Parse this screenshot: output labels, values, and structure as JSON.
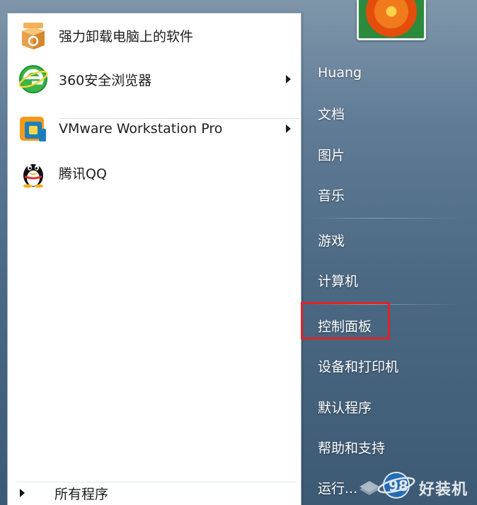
{
  "programs": [
    {
      "label": "强力卸载电脑上的软件",
      "icon": "uninstaller-box-icon",
      "has_submenu": false
    },
    {
      "label": "360安全浏览器",
      "icon": "360-browser-icon",
      "has_submenu": true
    },
    {
      "label": "VMware Workstation Pro",
      "icon": "vmware-icon",
      "has_submenu": true
    },
    {
      "label": "腾讯QQ",
      "icon": "qq-penguin-icon",
      "has_submenu": false
    }
  ],
  "all_programs_label": "所有程序",
  "places": [
    {
      "label": "Huang"
    },
    {
      "label": "文档"
    },
    {
      "label": "图片"
    },
    {
      "label": "音乐"
    },
    {
      "label": "游戏"
    },
    {
      "label": "计算机"
    },
    {
      "label": "控制面板",
      "highlighted": true
    },
    {
      "label": "设备和打印机"
    },
    {
      "label": "默认程序"
    },
    {
      "label": "帮助和支持"
    },
    {
      "label": "运行..."
    }
  ],
  "watermark": {
    "text": "好装机",
    "number": "98"
  },
  "colors": {
    "highlight_border": "#e0232a",
    "right_pane": "#4f6f88",
    "left_pane": "#ffffff"
  }
}
